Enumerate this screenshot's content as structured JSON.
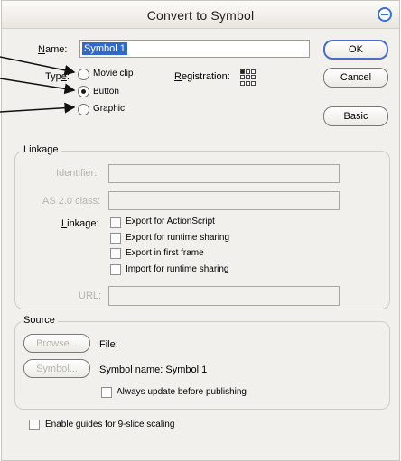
{
  "window": {
    "title": "Convert to Symbol"
  },
  "name": {
    "label": "Name:",
    "value": "Symbol 1"
  },
  "type": {
    "label": "Type:",
    "options": [
      {
        "label": "Movie clip",
        "checked": false
      },
      {
        "label": "Button",
        "checked": true
      },
      {
        "label": "Graphic",
        "checked": false
      }
    ]
  },
  "registration": {
    "label": "Registration:",
    "selected_point": "top-left"
  },
  "buttons": {
    "ok": "OK",
    "cancel": "Cancel",
    "basic": "Basic"
  },
  "linkage": {
    "title": "Linkage",
    "identifier_label": "Identifier:",
    "class_label": "AS 2.0 class:",
    "linkage_label": "Linkage:",
    "options": [
      {
        "label": "Export for ActionScript",
        "checked": false
      },
      {
        "label": "Export for runtime sharing",
        "checked": false
      },
      {
        "label": "Export in first frame",
        "checked": false
      },
      {
        "label": "Import for runtime sharing",
        "checked": false
      }
    ],
    "url_label": "URL:"
  },
  "source": {
    "title": "Source",
    "browse_button": "Browse...",
    "file_label": "File:",
    "symbol_button": "Symbol...",
    "symbol_name": "Symbol name: Symbol 1",
    "always_update": "Always update before publishing"
  },
  "guides": {
    "label": "Enable guides for 9-slice scaling"
  }
}
